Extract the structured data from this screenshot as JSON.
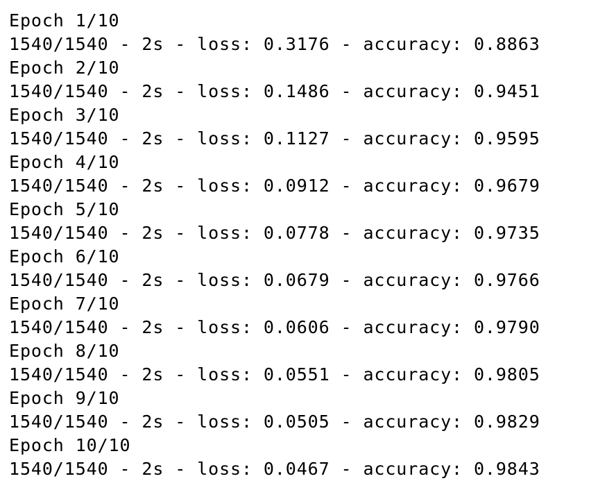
{
  "log": {
    "lines": [
      "Epoch 1/10",
      "1540/1540 - 2s - loss: 0.3176 - accuracy: 0.8863",
      "Epoch 2/10",
      "1540/1540 - 2s - loss: 0.1486 - accuracy: 0.9451",
      "Epoch 3/10",
      "1540/1540 - 2s - loss: 0.1127 - accuracy: 0.9595",
      "Epoch 4/10",
      "1540/1540 - 2s - loss: 0.0912 - accuracy: 0.9679",
      "Epoch 5/10",
      "1540/1540 - 2s - loss: 0.0778 - accuracy: 0.9735",
      "Epoch 6/10",
      "1540/1540 - 2s - loss: 0.0679 - accuracy: 0.9766",
      "Epoch 7/10",
      "1540/1540 - 2s - loss: 0.0606 - accuracy: 0.9790",
      "Epoch 8/10",
      "1540/1540 - 2s - loss: 0.0551 - accuracy: 0.9805",
      "Epoch 9/10",
      "1540/1540 - 2s - loss: 0.0505 - accuracy: 0.9829",
      "Epoch 10/10",
      "1540/1540 - 2s - loss: 0.0467 - accuracy: 0.9843"
    ]
  }
}
